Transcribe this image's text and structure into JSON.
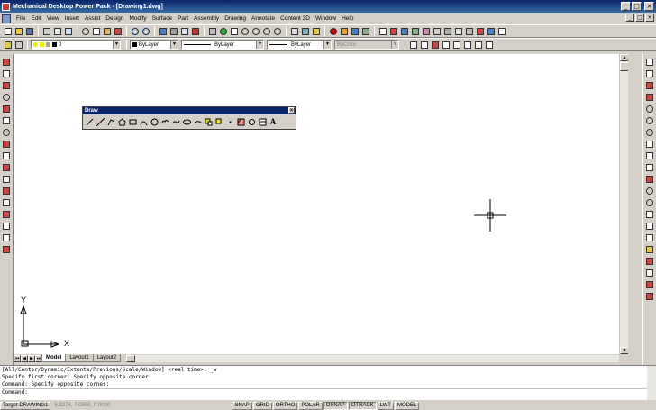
{
  "window": {
    "title": "Mechanical Desktop Power Pack - [Drawing1.dwg]",
    "minimize": "_",
    "maximize": "□",
    "close": "×"
  },
  "menu": {
    "items": [
      "File",
      "Edit",
      "View",
      "Insert",
      "Assist",
      "Design",
      "Modify",
      "Surface",
      "Part",
      "Assembly",
      "Drawing",
      "Annotate",
      "Content 3D",
      "Window",
      "Help"
    ]
  },
  "properties": {
    "layer": "0",
    "color": "ByLayer",
    "linetype": "ByLayer",
    "lineweight": "ByLayer",
    "plotstyle": "ByColor"
  },
  "draw_toolbar": {
    "title": "Draw",
    "close": "×"
  },
  "tabs": {
    "nav_first": "⏮",
    "nav_prev": "◀",
    "nav_next": "▶",
    "nav_last": "⏭",
    "items": [
      "Model",
      "Layout1",
      "Layout2"
    ]
  },
  "ucs": {
    "x": "X",
    "y": "Y"
  },
  "command": {
    "lines": [
      "[All/Center/Dynamic/Extents/Previous/Scale/Window] <real time>: _w",
      "Specify first corner: Specify opposite corner:",
      "Command: Specify opposite corner:"
    ],
    "prompt": "Command:"
  },
  "status": {
    "target": "Target DRAWING1",
    "coords": "6.8374, 7.0858, 0.0000",
    "toggles": [
      "SNAP",
      "GRID",
      "ORTHO",
      "POLAR",
      "OSNAP",
      "OTRACK",
      "LWT",
      "MODEL"
    ]
  }
}
